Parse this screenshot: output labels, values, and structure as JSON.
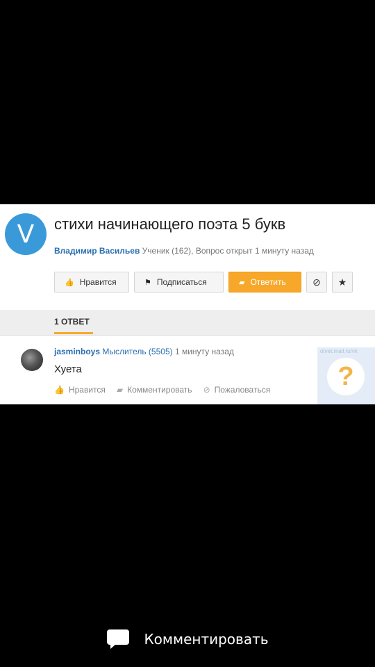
{
  "question": {
    "avatar_letter": "V",
    "title": "стихи начинающего поэта 5 букв",
    "author": "Владимир Васильев",
    "author_rank": "Ученик (162),",
    "status": "Вопрос открыт 1 минуту назад"
  },
  "buttons": {
    "like": "Нравится",
    "subscribe": "Подписаться",
    "answer": "Ответить",
    "block_icon": "⊘",
    "star_icon": "★"
  },
  "tabs": {
    "answers_count": "1 ОТВЕТ"
  },
  "answer": {
    "username": "jasminboys",
    "rank": "Мыслитель (5505)",
    "time": "1 минуту назад",
    "text": "Хуета",
    "actions": {
      "like": "Нравится",
      "comment": "Комментировать",
      "report": "Пожаловаться"
    }
  },
  "watermark": {
    "site": "otvet.mail.ru/vk",
    "symbol": "?"
  },
  "bottom_bar": {
    "comment_label": "Комментировать"
  },
  "colors": {
    "accent": "#f7a82a",
    "link": "#2a6fb0",
    "avatar": "#3a9ad9"
  }
}
